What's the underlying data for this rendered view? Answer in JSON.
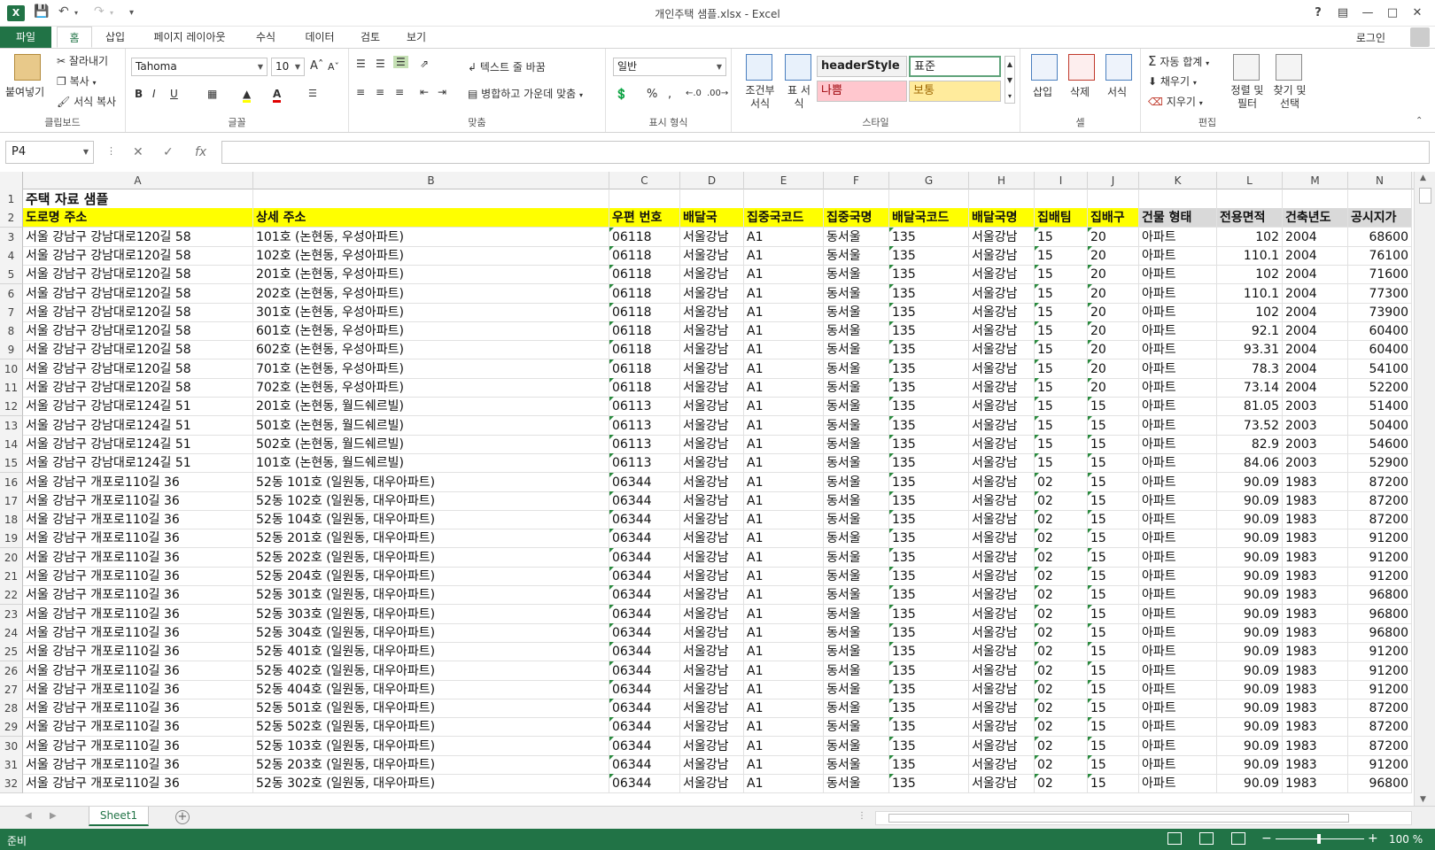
{
  "window": {
    "title": "개인주택 샘플.xlsx - Excel",
    "help": "?",
    "logo": "X"
  },
  "tabs": {
    "file": "파일",
    "items": [
      "홈",
      "삽입",
      "페이지 레이아웃",
      "수식",
      "데이터",
      "검토",
      "보기"
    ],
    "login": "로그인"
  },
  "ribbon": {
    "clipboard": {
      "label": "클립보드",
      "paste": "붙여넣기",
      "cut": "잘라내기",
      "copy": "복사",
      "format_painter": "서식 복사"
    },
    "font": {
      "label": "글꼴",
      "name": "Tahoma",
      "size": "10"
    },
    "alignment": {
      "label": "맞춤",
      "wrap": "텍스트 줄 바꿈",
      "merge": "병합하고 가운데 맞춤"
    },
    "number": {
      "label": "표시 형식",
      "format": "일반"
    },
    "styles": {
      "label": "스타일",
      "conditional": "조건부 서식",
      "table": "표 서식",
      "header_style": "headerStyle",
      "normal": "표준",
      "bad": "나쁨",
      "neutral": "보통"
    },
    "cells": {
      "label": "셀",
      "insert": "삽입",
      "delete": "삭제",
      "format": "서식"
    },
    "editing": {
      "label": "편집",
      "autosum": "자동 합계",
      "fill": "채우기",
      "clear": "지우기",
      "sort": "정렬 및 필터",
      "find": "찾기 및 선택"
    }
  },
  "formula_bar": {
    "name_box": "P4",
    "formula": ""
  },
  "grid": {
    "columns": [
      "A",
      "B",
      "C",
      "D",
      "E",
      "F",
      "G",
      "H",
      "I",
      "J",
      "K",
      "L",
      "M",
      "N"
    ],
    "title_row": "주택 자료 샘플",
    "headers": [
      "도로명 주소",
      "상세 주소",
      "우편 번호",
      "배달국",
      "집중국코드",
      "집중국명",
      "배달국코드",
      "배달국명",
      "집배팀",
      "집배구",
      "건물 형태",
      "전용면적",
      "건축년도",
      "공시지가"
    ],
    "rows": [
      [
        "서울 강남구 강남대로120길 58",
        "101호 (논현동, 우성아파트)",
        "06118",
        "서울강남",
        "A1",
        "동서울",
        "135",
        "서울강남",
        "15",
        "20",
        "아파트",
        "102",
        "2004",
        "68600"
      ],
      [
        "서울 강남구 강남대로120길 58",
        "102호 (논현동, 우성아파트)",
        "06118",
        "서울강남",
        "A1",
        "동서울",
        "135",
        "서울강남",
        "15",
        "20",
        "아파트",
        "110.1",
        "2004",
        "76100"
      ],
      [
        "서울 강남구 강남대로120길 58",
        "201호 (논현동, 우성아파트)",
        "06118",
        "서울강남",
        "A1",
        "동서울",
        "135",
        "서울강남",
        "15",
        "20",
        "아파트",
        "102",
        "2004",
        "71600"
      ],
      [
        "서울 강남구 강남대로120길 58",
        "202호 (논현동, 우성아파트)",
        "06118",
        "서울강남",
        "A1",
        "동서울",
        "135",
        "서울강남",
        "15",
        "20",
        "아파트",
        "110.1",
        "2004",
        "77300"
      ],
      [
        "서울 강남구 강남대로120길 58",
        "301호 (논현동, 우성아파트)",
        "06118",
        "서울강남",
        "A1",
        "동서울",
        "135",
        "서울강남",
        "15",
        "20",
        "아파트",
        "102",
        "2004",
        "73900"
      ],
      [
        "서울 강남구 강남대로120길 58",
        "601호 (논현동, 우성아파트)",
        "06118",
        "서울강남",
        "A1",
        "동서울",
        "135",
        "서울강남",
        "15",
        "20",
        "아파트",
        "92.1",
        "2004",
        "60400"
      ],
      [
        "서울 강남구 강남대로120길 58",
        "602호 (논현동, 우성아파트)",
        "06118",
        "서울강남",
        "A1",
        "동서울",
        "135",
        "서울강남",
        "15",
        "20",
        "아파트",
        "93.31",
        "2004",
        "60400"
      ],
      [
        "서울 강남구 강남대로120길 58",
        "701호 (논현동, 우성아파트)",
        "06118",
        "서울강남",
        "A1",
        "동서울",
        "135",
        "서울강남",
        "15",
        "20",
        "아파트",
        "78.3",
        "2004",
        "54100"
      ],
      [
        "서울 강남구 강남대로120길 58",
        "702호 (논현동, 우성아파트)",
        "06118",
        "서울강남",
        "A1",
        "동서울",
        "135",
        "서울강남",
        "15",
        "20",
        "아파트",
        "73.14",
        "2004",
        "52200"
      ],
      [
        "서울 강남구 강남대로124길 51",
        "201호 (논현동, 월드쉐르빌)",
        "06113",
        "서울강남",
        "A1",
        "동서울",
        "135",
        "서울강남",
        "15",
        "15",
        "아파트",
        "81.05",
        "2003",
        "51400"
      ],
      [
        "서울 강남구 강남대로124길 51",
        "501호 (논현동, 월드쉐르빌)",
        "06113",
        "서울강남",
        "A1",
        "동서울",
        "135",
        "서울강남",
        "15",
        "15",
        "아파트",
        "73.52",
        "2003",
        "50400"
      ],
      [
        "서울 강남구 강남대로124길 51",
        "502호 (논현동, 월드쉐르빌)",
        "06113",
        "서울강남",
        "A1",
        "동서울",
        "135",
        "서울강남",
        "15",
        "15",
        "아파트",
        "82.9",
        "2003",
        "54600"
      ],
      [
        "서울 강남구 강남대로124길 51",
        "101호 (논현동, 월드쉐르빌)",
        "06113",
        "서울강남",
        "A1",
        "동서울",
        "135",
        "서울강남",
        "15",
        "15",
        "아파트",
        "84.06",
        "2003",
        "52900"
      ],
      [
        "서울 강남구 개포로110길 36",
        "52동 101호 (일원동, 대우아파트)",
        "06344",
        "서울강남",
        "A1",
        "동서울",
        "135",
        "서울강남",
        "02",
        "15",
        "아파트",
        "90.09",
        "1983",
        "87200"
      ],
      [
        "서울 강남구 개포로110길 36",
        "52동 102호 (일원동, 대우아파트)",
        "06344",
        "서울강남",
        "A1",
        "동서울",
        "135",
        "서울강남",
        "02",
        "15",
        "아파트",
        "90.09",
        "1983",
        "87200"
      ],
      [
        "서울 강남구 개포로110길 36",
        "52동 104호 (일원동, 대우아파트)",
        "06344",
        "서울강남",
        "A1",
        "동서울",
        "135",
        "서울강남",
        "02",
        "15",
        "아파트",
        "90.09",
        "1983",
        "87200"
      ],
      [
        "서울 강남구 개포로110길 36",
        "52동 201호 (일원동, 대우아파트)",
        "06344",
        "서울강남",
        "A1",
        "동서울",
        "135",
        "서울강남",
        "02",
        "15",
        "아파트",
        "90.09",
        "1983",
        "91200"
      ],
      [
        "서울 강남구 개포로110길 36",
        "52동 202호 (일원동, 대우아파트)",
        "06344",
        "서울강남",
        "A1",
        "동서울",
        "135",
        "서울강남",
        "02",
        "15",
        "아파트",
        "90.09",
        "1983",
        "91200"
      ],
      [
        "서울 강남구 개포로110길 36",
        "52동 204호 (일원동, 대우아파트)",
        "06344",
        "서울강남",
        "A1",
        "동서울",
        "135",
        "서울강남",
        "02",
        "15",
        "아파트",
        "90.09",
        "1983",
        "91200"
      ],
      [
        "서울 강남구 개포로110길 36",
        "52동 301호 (일원동, 대우아파트)",
        "06344",
        "서울강남",
        "A1",
        "동서울",
        "135",
        "서울강남",
        "02",
        "15",
        "아파트",
        "90.09",
        "1983",
        "96800"
      ],
      [
        "서울 강남구 개포로110길 36",
        "52동 303호 (일원동, 대우아파트)",
        "06344",
        "서울강남",
        "A1",
        "동서울",
        "135",
        "서울강남",
        "02",
        "15",
        "아파트",
        "90.09",
        "1983",
        "96800"
      ],
      [
        "서울 강남구 개포로110길 36",
        "52동 304호 (일원동, 대우아파트)",
        "06344",
        "서울강남",
        "A1",
        "동서울",
        "135",
        "서울강남",
        "02",
        "15",
        "아파트",
        "90.09",
        "1983",
        "96800"
      ],
      [
        "서울 강남구 개포로110길 36",
        "52동 401호 (일원동, 대우아파트)",
        "06344",
        "서울강남",
        "A1",
        "동서울",
        "135",
        "서울강남",
        "02",
        "15",
        "아파트",
        "90.09",
        "1983",
        "91200"
      ],
      [
        "서울 강남구 개포로110길 36",
        "52동 402호 (일원동, 대우아파트)",
        "06344",
        "서울강남",
        "A1",
        "동서울",
        "135",
        "서울강남",
        "02",
        "15",
        "아파트",
        "90.09",
        "1983",
        "91200"
      ],
      [
        "서울 강남구 개포로110길 36",
        "52동 404호 (일원동, 대우아파트)",
        "06344",
        "서울강남",
        "A1",
        "동서울",
        "135",
        "서울강남",
        "02",
        "15",
        "아파트",
        "90.09",
        "1983",
        "91200"
      ],
      [
        "서울 강남구 개포로110길 36",
        "52동 501호 (일원동, 대우아파트)",
        "06344",
        "서울강남",
        "A1",
        "동서울",
        "135",
        "서울강남",
        "02",
        "15",
        "아파트",
        "90.09",
        "1983",
        "87200"
      ],
      [
        "서울 강남구 개포로110길 36",
        "52동 502호 (일원동, 대우아파트)",
        "06344",
        "서울강남",
        "A1",
        "동서울",
        "135",
        "서울강남",
        "02",
        "15",
        "아파트",
        "90.09",
        "1983",
        "87200"
      ],
      [
        "서울 강남구 개포로110길 36",
        "52동 103호 (일원동, 대우아파트)",
        "06344",
        "서울강남",
        "A1",
        "동서울",
        "135",
        "서울강남",
        "02",
        "15",
        "아파트",
        "90.09",
        "1983",
        "87200"
      ],
      [
        "서울 강남구 개포로110길 36",
        "52동 203호 (일원동, 대우아파트)",
        "06344",
        "서울강남",
        "A1",
        "동서울",
        "135",
        "서울강남",
        "02",
        "15",
        "아파트",
        "90.09",
        "1983",
        "91200"
      ],
      [
        "서울 강남구 개포로110길 36",
        "52동 302호 (일원동, 대우아파트)",
        "06344",
        "서울강남",
        "A1",
        "동서울",
        "135",
        "서울강남",
        "02",
        "15",
        "아파트",
        "90.09",
        "1983",
        "96800"
      ]
    ],
    "header_fill": "#ffff00",
    "header_gray_fill": "#d9d9d9"
  },
  "sheets": {
    "tabs": [
      "Sheet1"
    ]
  },
  "status": {
    "ready": "준비",
    "zoom": "100 %"
  },
  "colors": {
    "excel_green": "#217346"
  }
}
